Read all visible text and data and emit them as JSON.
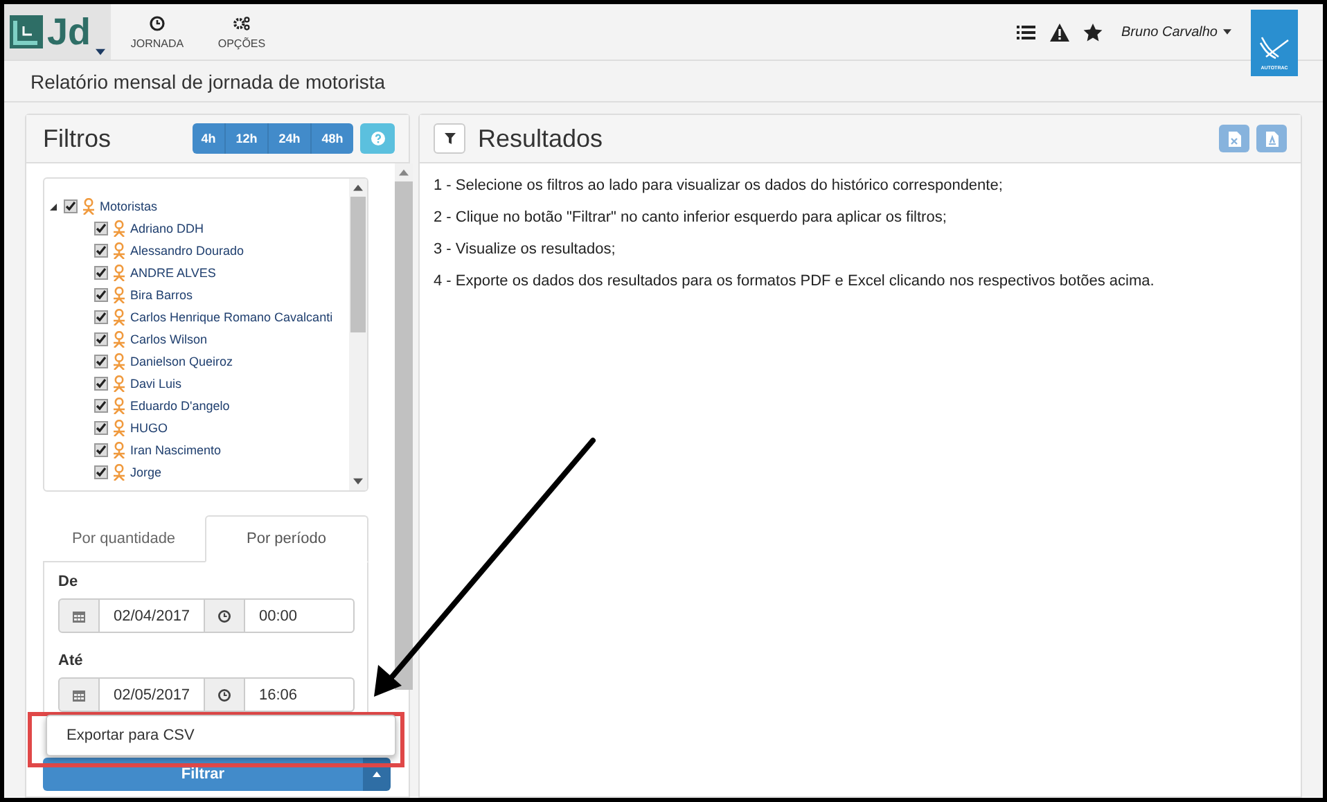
{
  "nav": {
    "logo_text": "Jd",
    "items": [
      {
        "label": "JORNADA",
        "kind": "clock"
      },
      {
        "label": "OPÇÕES",
        "kind": "gears"
      }
    ],
    "user": "Bruno Carvalho",
    "brand_text": "AUTOTRAC"
  },
  "page_title": "Relatório mensal de jornada de motorista",
  "filters": {
    "title": "Filtros",
    "ranges": [
      {
        "label": "4h"
      },
      {
        "label": "12h"
      },
      {
        "label": "24h"
      },
      {
        "label": "48h"
      }
    ],
    "tree": [
      {
        "label": "Motoristas",
        "checked": true,
        "expanded": true,
        "children": [
          {
            "label": "Adriano DDH",
            "checked": true
          },
          {
            "label": "Alessandro Dourado",
            "checked": true
          },
          {
            "label": "ANDRE ALVES",
            "checked": true
          },
          {
            "label": "Bira Barros",
            "checked": true
          },
          {
            "label": "Carlos Henrique Romano Cavalcanti",
            "checked": true
          },
          {
            "label": "Carlos Wilson",
            "checked": true
          },
          {
            "label": "Danielson Queiroz",
            "checked": true
          },
          {
            "label": "Davi Luis",
            "checked": true
          },
          {
            "label": "Eduardo D'angelo",
            "checked": true
          },
          {
            "label": "HUGO",
            "checked": true
          },
          {
            "label": "Iran Nascimento",
            "checked": true
          },
          {
            "label": "Jorge",
            "checked": true
          }
        ]
      }
    ],
    "tabs": [
      {
        "label": "Por quantidade",
        "selected": false
      },
      {
        "label": "Por período",
        "selected": true
      }
    ],
    "fields": [
      {
        "label": "De",
        "date": "02/04/2017",
        "time": "00:00"
      },
      {
        "label": "Até",
        "date": "02/05/2017",
        "time": "16:06"
      }
    ],
    "filter_button": "Filtrar",
    "menu": [
      "Exportar para CSV"
    ]
  },
  "results": {
    "title": "Resultados",
    "instructions": [
      "1 - Selecione os filtros ao lado para visualizar os dados do histórico correspondente;",
      "2 - Clique no botão \"Filtrar\" no canto inferior esquerdo para aplicar os filtros;",
      "3 - Visualize os resultados;",
      "4 - Exporte os dados dos resultados para os formatos PDF e Excel clicando nos respectivos botões acima."
    ]
  }
}
